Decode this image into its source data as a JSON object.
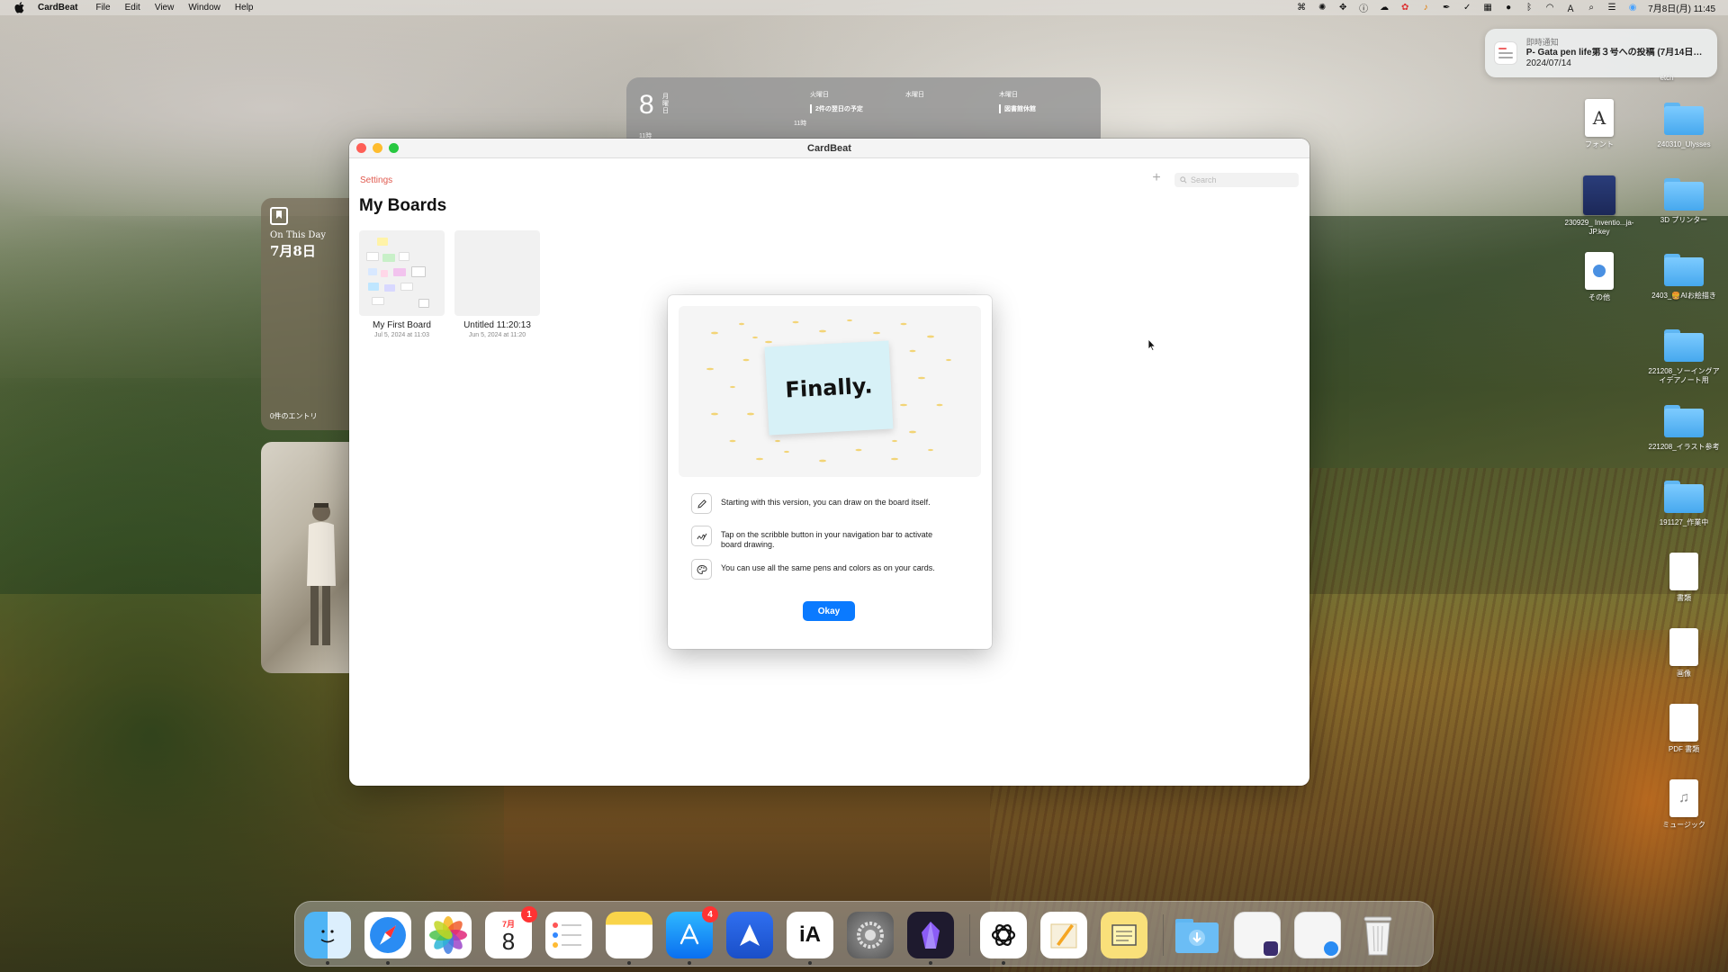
{
  "menubar": {
    "app_name": "CardBeat",
    "menus": [
      "File",
      "Edit",
      "View",
      "Window",
      "Help"
    ],
    "clock": "7月8日(月) 11:45",
    "status_icons": [
      "lasso-icon",
      "openai-icon",
      "sync-icon",
      "info-icon",
      "cloud-icon",
      "gift-icon",
      "bell-icon",
      "pen-icon",
      "check-icon",
      "grid-icon",
      "person-icon",
      "bluetooth-icon",
      "wifi-icon",
      "input-icon",
      "search-icon",
      "control-center-icon",
      "siri-icon"
    ]
  },
  "notification": {
    "app": "即時通知",
    "title": "P- Gata pen life第３号への投稿 (7月14日…",
    "date": "2024/07/14"
  },
  "calendar_widget": {
    "day": "8",
    "day_info": "月曜日",
    "col1_header": "火曜日",
    "col1_event": "2件の翌日の予定",
    "col2_header": "水曜日",
    "col3_header": "木曜日",
    "col3_event": "図書館休館",
    "time1": "11時",
    "time2": "11時"
  },
  "on_this_day": {
    "label": "On This Day",
    "date": "7月8日",
    "entries": "0件のエントリ"
  },
  "window": {
    "title": "CardBeat",
    "settings_label": "Settings",
    "add_symbol": "+",
    "search_placeholder": "Search",
    "page_title": "My Boards",
    "boards": [
      {
        "name": "My First Board",
        "date": "Jul 5, 2024 at 11:03"
      },
      {
        "name": "Untitled 11:20:13",
        "date": "Jun 5, 2024 at 11:20"
      }
    ]
  },
  "modal": {
    "hero_text": "Finally.",
    "features": [
      {
        "icon": "pencil-icon",
        "text": "Starting with this version, you can draw on the board itself."
      },
      {
        "icon": "scribble-icon",
        "text": "Tap on the scribble button in your navigation bar to activate board drawing."
      },
      {
        "icon": "palette-icon",
        "text": "You can use all the same pens and colors as on your cards."
      }
    ],
    "okay_label": "Okay"
  },
  "desktop_icons": [
    {
      "label": "etch",
      "type": "partial"
    },
    {
      "label": "フォント",
      "type": "font"
    },
    {
      "label": "240310_Ulysses",
      "type": "folder"
    },
    {
      "label": "230929_ Inventio...ja-JP.key",
      "type": "keynote"
    },
    {
      "label": "3D プリンター",
      "type": "folder"
    },
    {
      "label": "その他",
      "type": "doc"
    },
    {
      "label": "2403_🍔AIお絵描き",
      "type": "folder"
    },
    {
      "label": "221208_ソーイングアイデアノート用",
      "type": "folder"
    },
    {
      "label": "221208_イラスト参考",
      "type": "folder"
    },
    {
      "label": "191127_作業中",
      "type": "folder"
    },
    {
      "label": "書類",
      "type": "doc"
    },
    {
      "label": "画像",
      "type": "doc"
    },
    {
      "label": "PDF 書類",
      "type": "doc"
    },
    {
      "label": "ミュージック",
      "type": "doc"
    }
  ],
  "dock": {
    "apps": [
      "Finder",
      "Safari",
      "Photos",
      "Calendar",
      "Reminders",
      "Notes",
      "App Store",
      "Spark",
      "iA Writer",
      "System Settings",
      "Obsidian",
      "ChatGPT",
      "Pages",
      "Stickies",
      "Downloads",
      "Recent 1",
      "Recent 2",
      "Trash"
    ],
    "calendar_month": "7月",
    "calendar_day": "8",
    "calendar_badge": "1",
    "appstore_badge": "4",
    "ia_label": "iA"
  }
}
